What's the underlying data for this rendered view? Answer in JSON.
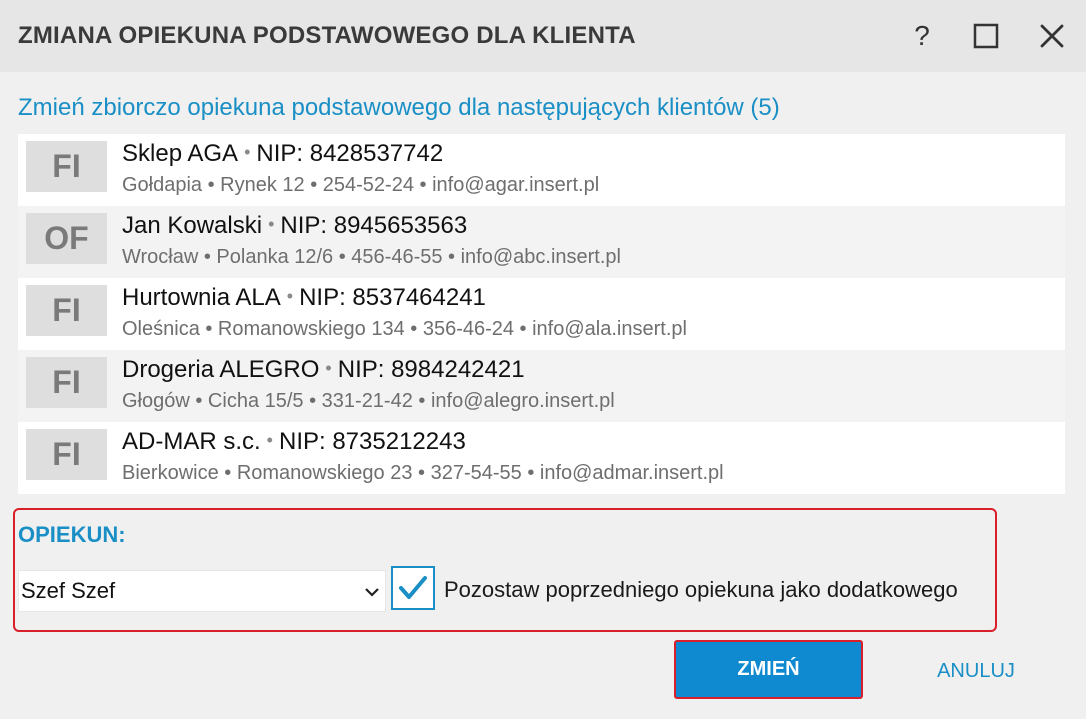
{
  "dialog": {
    "title": "ZMIANA OPIEKUNA PODSTAWOWEGO DLA KLIENTA",
    "help_label": "?",
    "subtitle": "Zmień zbiorczo opiekuna podstawowego dla następujących klientów (5)"
  },
  "clients": [
    {
      "badge": "FI",
      "name": "Sklep AGA",
      "nip": "NIP: 8428537742",
      "details": "Gołdapia • Rynek 12 • 254-52-24 • info@agar.insert.pl"
    },
    {
      "badge": "OF",
      "name": "Jan Kowalski",
      "nip": "NIP: 8945653563",
      "details": "Wrocław • Polanka  12/6 • 456-46-55 • info@abc.insert.pl"
    },
    {
      "badge": "FI",
      "name": "Hurtownia ALA",
      "nip": "NIP: 8537464241",
      "details": "Oleśnica • Romanowskiego 134 • 356-46-24 • info@ala.insert.pl"
    },
    {
      "badge": "FI",
      "name": "Drogeria ALEGRO",
      "nip": "NIP: 8984242421",
      "details": "Głogów • Cicha  15/5 • 331-21-42 • info@alegro.insert.pl"
    },
    {
      "badge": "FI",
      "name": "AD-MAR s.c.",
      "nip": "NIP: 8735212243",
      "details": "Bierkowice • Romanowskiego 23 • 327-54-55 • info@admar.insert.pl"
    }
  ],
  "opiekun": {
    "label": "OPIEKUN:",
    "selected": "Szef Szef",
    "keep_previous_checked": true,
    "keep_previous_label": "Pozostaw poprzedniego opiekuna jako dodatkowego"
  },
  "actions": {
    "confirm_label": "ZMIEŃ",
    "cancel_label": "ANULUJ"
  },
  "colors": {
    "accent": "#1a8fc6",
    "primary_button": "#0f8ad0",
    "highlight_border": "#d9202a"
  }
}
